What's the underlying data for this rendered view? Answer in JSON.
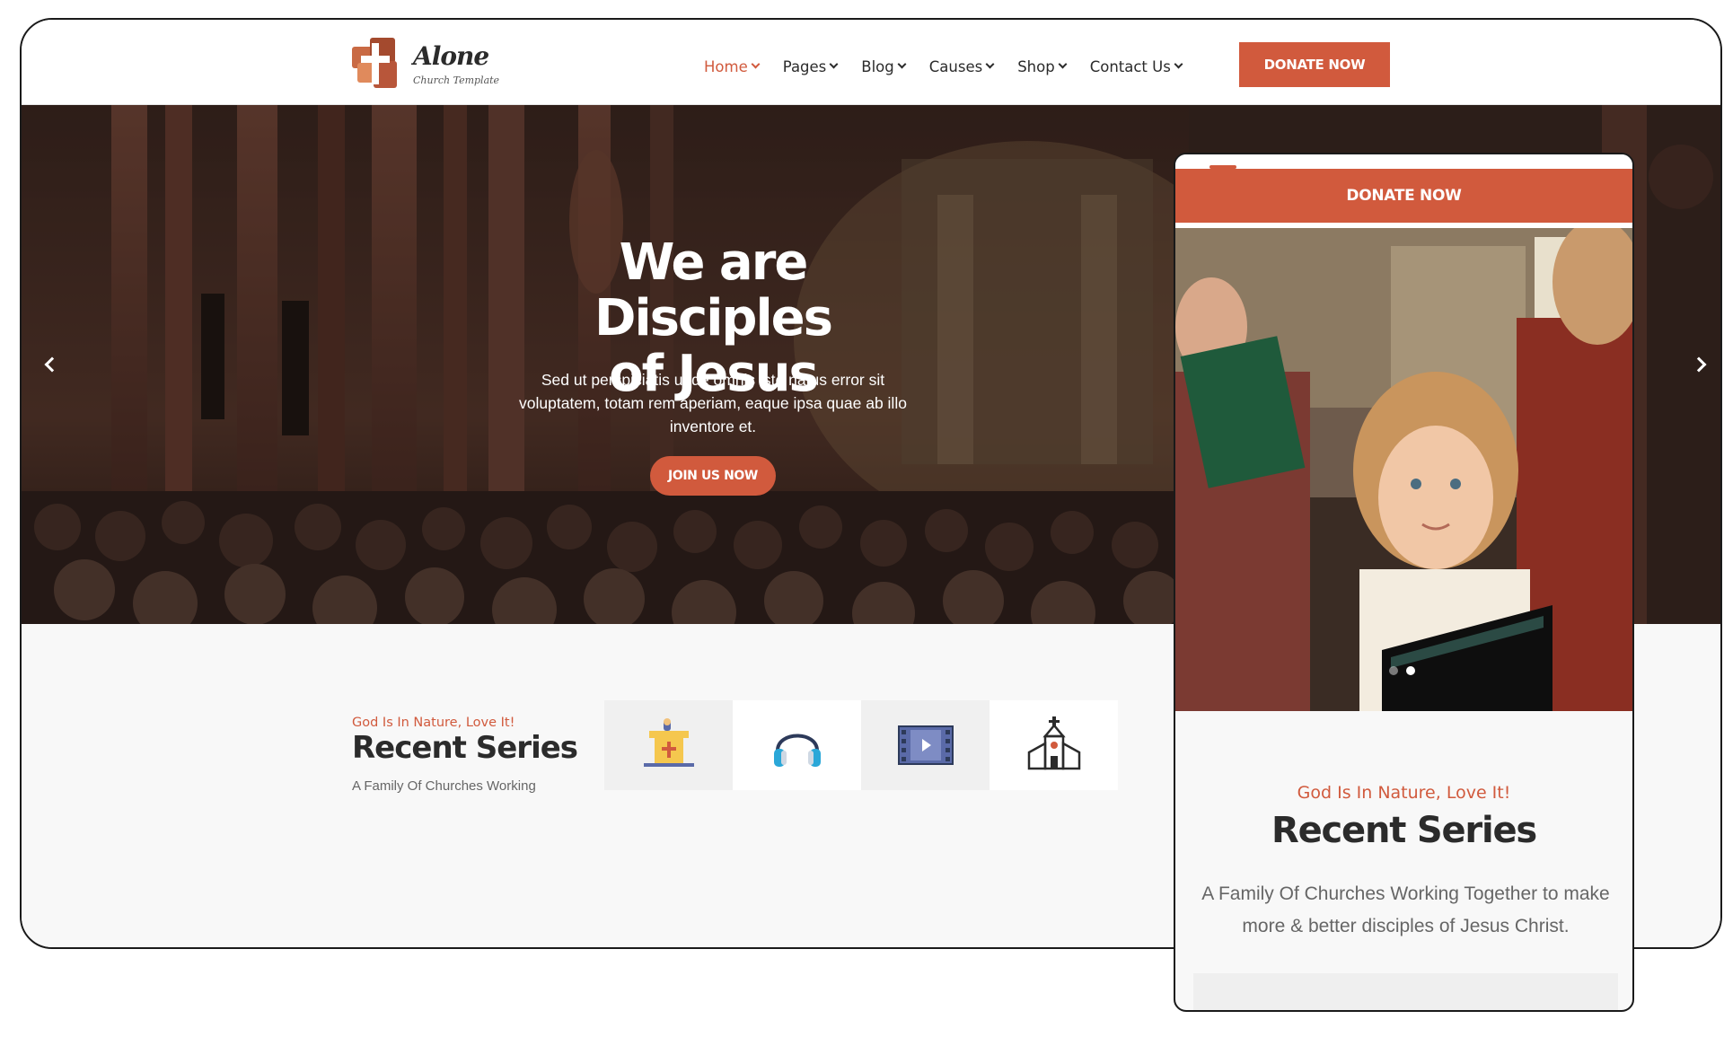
{
  "brand": {
    "name": "Alone",
    "tagline": "Church Template",
    "accent_color": "#d15a3d",
    "dark_text_color": "#2b2b2b"
  },
  "nav": {
    "items": [
      {
        "label": "Home",
        "active": true
      },
      {
        "label": "Pages",
        "active": false
      },
      {
        "label": "Blog",
        "active": false
      },
      {
        "label": "Causes",
        "active": false
      },
      {
        "label": "Shop",
        "active": false
      },
      {
        "label": "Contact Us",
        "active": false
      }
    ],
    "donate_label": "DONATE NOW"
  },
  "hero": {
    "title_line1": "We are Disciples",
    "title_line2": "of Jesus",
    "text": "Sed ut perspiciatis unde omnis iste natus error sit voluptatem, totam rem aperiam, eaque ipsa quae ab illo inventore et.",
    "button_label": "JOIN US NOW",
    "prev_icon": "chevron-left-icon",
    "next_icon": "chevron-right-icon"
  },
  "series": {
    "subtitle": "God Is In Nature, Love It!",
    "title": "Recent Series",
    "description": "A Family Of Churches Working",
    "icons": [
      "pulpit-icon",
      "headphones-icon",
      "video-icon",
      "church-icon"
    ]
  },
  "mobile": {
    "donate_label": "DONATE NOW",
    "subtitle": "God Is In Nature, Love It!",
    "title": "Recent Series",
    "description": "A Family Of Churches Working Together to make more & better disciples of Jesus Christ.",
    "slide_count": 2,
    "active_slide": 2
  }
}
